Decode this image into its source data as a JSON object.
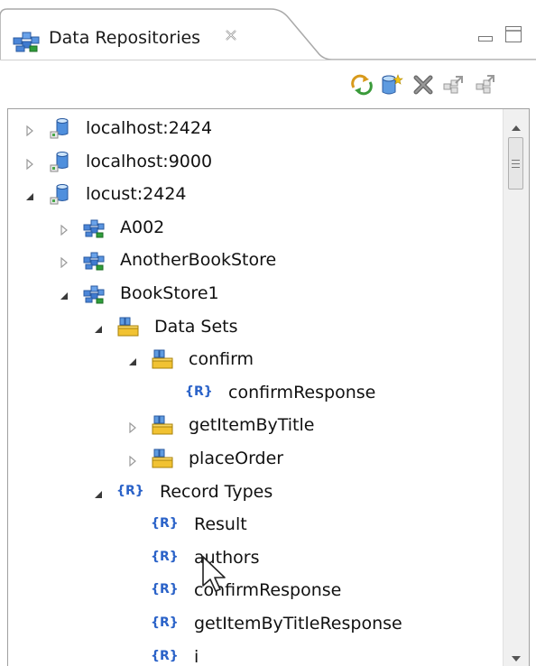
{
  "view": {
    "title": "Data Repositories",
    "tab_icon": "data-repository-icon",
    "close_icon": "close-tab-icon",
    "minimize_icon": "minimize-icon",
    "maximize_icon": "maximize-icon"
  },
  "toolbar": {
    "buttons": [
      {
        "name": "refresh",
        "icon": "refresh-icon"
      },
      {
        "name": "add-repository",
        "icon": "add-database-icon"
      },
      {
        "name": "delete",
        "icon": "delete-icon"
      },
      {
        "name": "import",
        "icon": "import-icon"
      },
      {
        "name": "export",
        "icon": "export-icon"
      }
    ]
  },
  "tree": [
    {
      "label": "localhost:2424",
      "icon": "server-icon",
      "depth": 0,
      "state": "collapsed"
    },
    {
      "label": "localhost:9000",
      "icon": "server-icon",
      "depth": 0,
      "state": "collapsed"
    },
    {
      "label": "locust:2424",
      "icon": "server-icon",
      "depth": 0,
      "state": "expanded"
    },
    {
      "label": "A002",
      "icon": "repository-icon",
      "depth": 1,
      "state": "collapsed"
    },
    {
      "label": "AnotherBookStore",
      "icon": "repository-icon",
      "depth": 1,
      "state": "collapsed"
    },
    {
      "label": "BookStore1",
      "icon": "repository-icon",
      "depth": 1,
      "state": "expanded"
    },
    {
      "label": "Data Sets",
      "icon": "dataset-folder-icon",
      "depth": 2,
      "state": "expanded"
    },
    {
      "label": "confirm",
      "icon": "dataset-icon",
      "depth": 3,
      "state": "expanded"
    },
    {
      "label": "confirmResponse",
      "icon": "record-icon",
      "depth": 4,
      "state": "leaf"
    },
    {
      "label": "getItemByTitle",
      "icon": "dataset-icon",
      "depth": 3,
      "state": "collapsed"
    },
    {
      "label": "placeOrder",
      "icon": "dataset-icon",
      "depth": 3,
      "state": "collapsed"
    },
    {
      "label": "Record Types",
      "icon": "record-icon",
      "depth": 2,
      "state": "expanded"
    },
    {
      "label": "Result",
      "icon": "record-icon",
      "depth": 3,
      "state": "leaf"
    },
    {
      "label": "authors",
      "icon": "record-icon",
      "depth": 3,
      "state": "leaf"
    },
    {
      "label": "confirmResponse",
      "icon": "record-icon",
      "depth": 3,
      "state": "leaf"
    },
    {
      "label": "getItemByTitleResponse",
      "icon": "record-icon",
      "depth": 3,
      "state": "leaf"
    },
    {
      "label": "i",
      "icon": "record-icon",
      "depth": 3,
      "state": "leaf"
    }
  ],
  "record_badge": "{R}",
  "colors": {
    "record_badge": "#2a62c8",
    "panel_border": "#a0a0a0"
  }
}
